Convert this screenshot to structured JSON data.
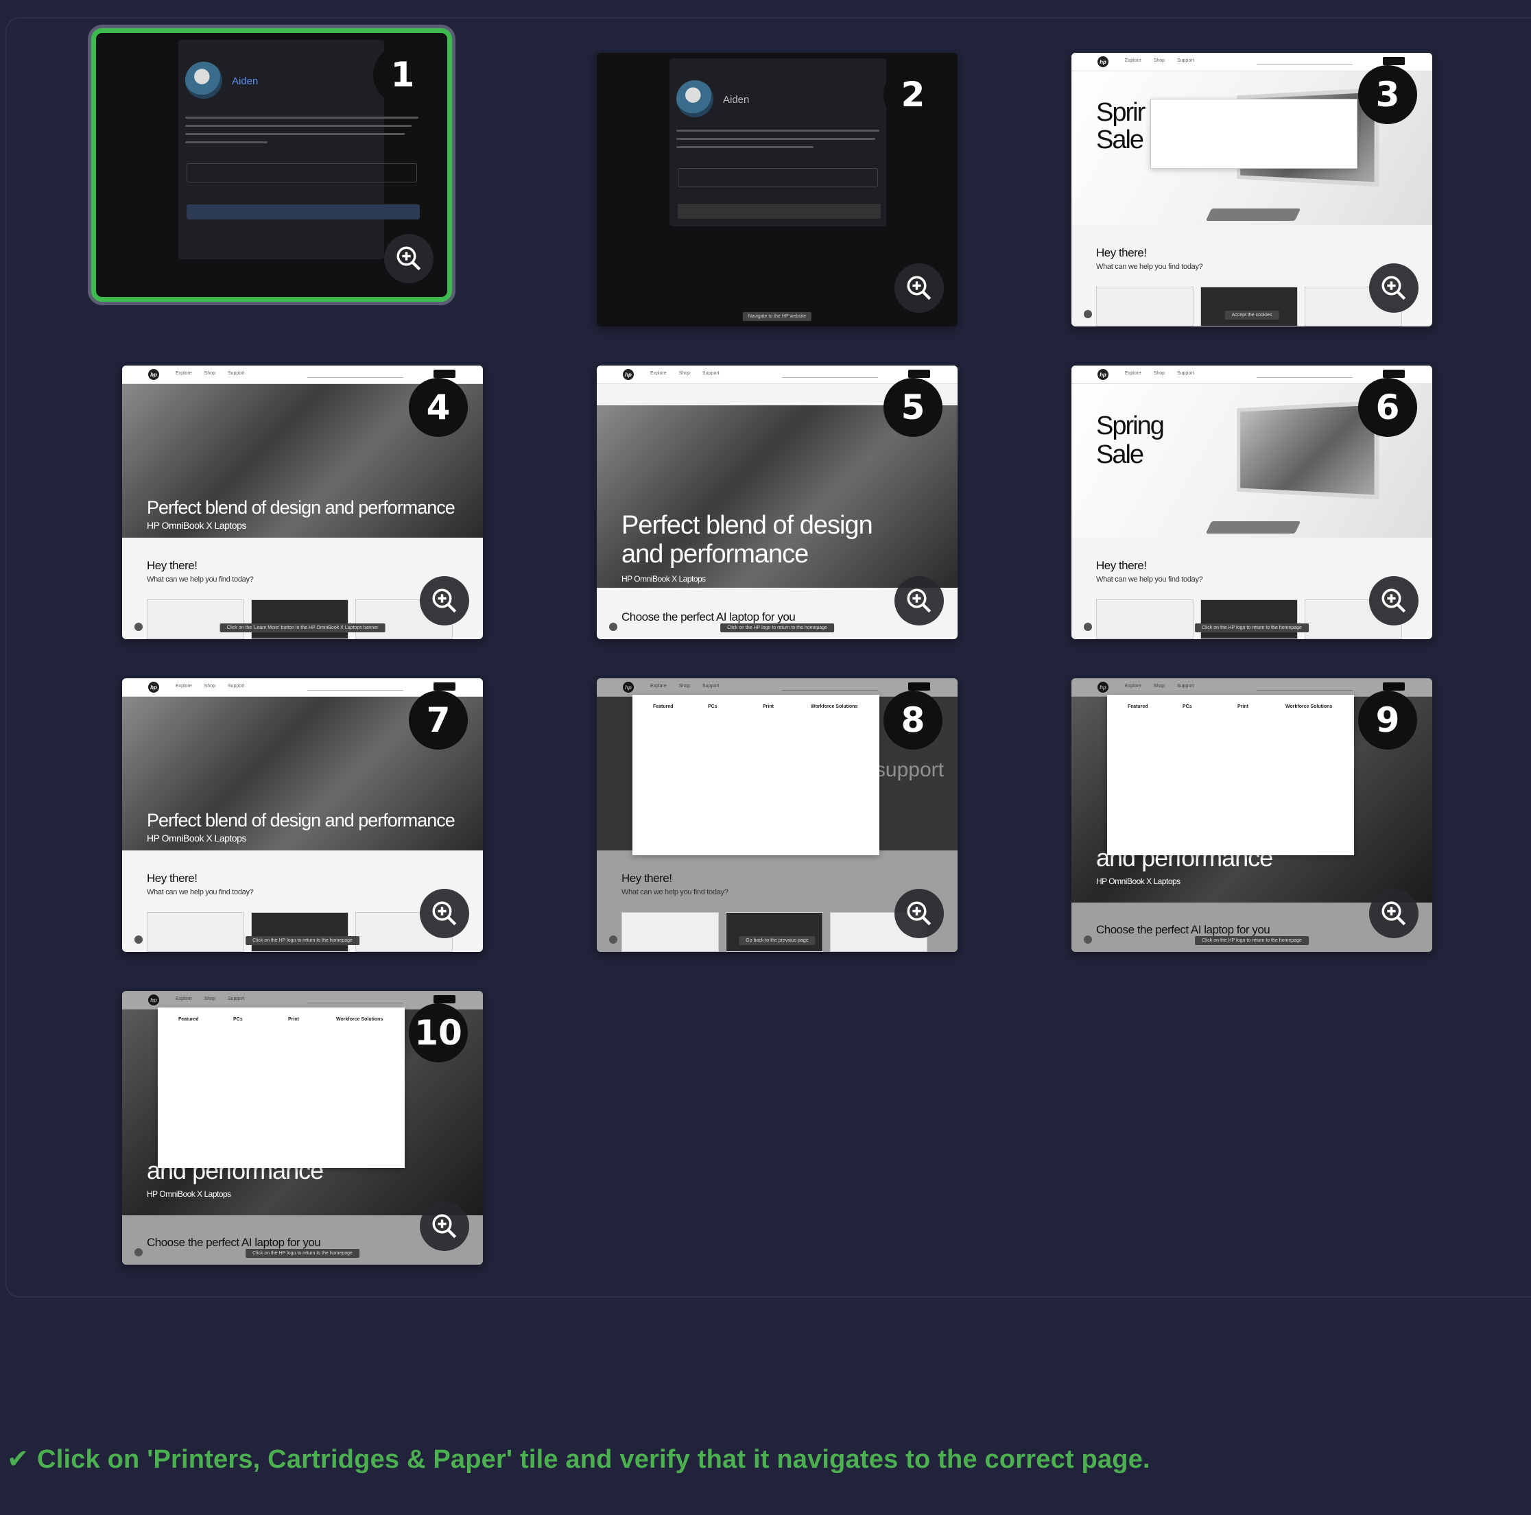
{
  "tiles": [
    {
      "num": "1",
      "kind": "dialog",
      "name": "Aiden",
      "selected": true
    },
    {
      "num": "2",
      "kind": "dialog",
      "name": "Aiden",
      "caption": "Navigate to the HP website"
    },
    {
      "num": "3",
      "kind": "spring-cookie",
      "hero_title": "Sprir\nSale",
      "hey": "Hey there!",
      "help": "What can we help you find today?",
      "caption": "Accept the cookies"
    },
    {
      "num": "4",
      "kind": "perfect",
      "hero_title": "Perfect blend of design and performance",
      "hero_sub": "HP OmniBook X Laptops",
      "hey": "Hey there!",
      "help": "What can we help you find today?",
      "caption": "Click on the 'Learn More' button in the HP OmniBook X Laptops banner"
    },
    {
      "num": "5",
      "kind": "perfect-big",
      "hero_title": "Perfect blend of design and performance",
      "hero_sub": "HP OmniBook X Laptops",
      "choose": "Choose the perfect AI laptop for you",
      "caption": "Click on the HP logo to return to the homepage"
    },
    {
      "num": "6",
      "kind": "spring",
      "hero_title": "Spring Sale",
      "hey": "Hey there!",
      "help": "What can we help you find today?",
      "caption": "Click on the HP logo to return to the homepage"
    },
    {
      "num": "7",
      "kind": "perfect",
      "hero_title": "Perfect blend of design and performance",
      "hero_sub": "HP OmniBook X Laptops",
      "hey": "Hey there!",
      "help": "What can we help you find today?",
      "caption": "Click on the HP logo to return to the homepage"
    },
    {
      "num": "8",
      "kind": "menu-hey",
      "hey": "Hey there!",
      "help": "What can we help you find today?",
      "support": "24/7 support",
      "caption": "Go back to the previous page"
    },
    {
      "num": "9",
      "kind": "menu-perf",
      "hero_title": "and performance",
      "hero_sub": "HP OmniBook X Laptops",
      "choose": "Choose the perfect AI laptop for you",
      "caption": "Click on the HP logo to return to the homepage"
    },
    {
      "num": "10",
      "kind": "menu-perf",
      "hero_title": "and performance",
      "hero_sub": "HP OmniBook X Laptops",
      "choose": "Choose the perfect AI laptop for you",
      "caption": "Click on the HP logo to return to the homepage"
    }
  ],
  "menu_columns": [
    "Featured",
    "PCs",
    "Print",
    "Workforce Solutions"
  ],
  "status": {
    "check": "✔",
    "message": "Click on 'Printers, Cartridges & Paper' tile and verify that it navigates to the correct page."
  },
  "colors": {
    "background": "#202339",
    "success": "#4caf50",
    "selected_border": "#3dbb4f"
  }
}
